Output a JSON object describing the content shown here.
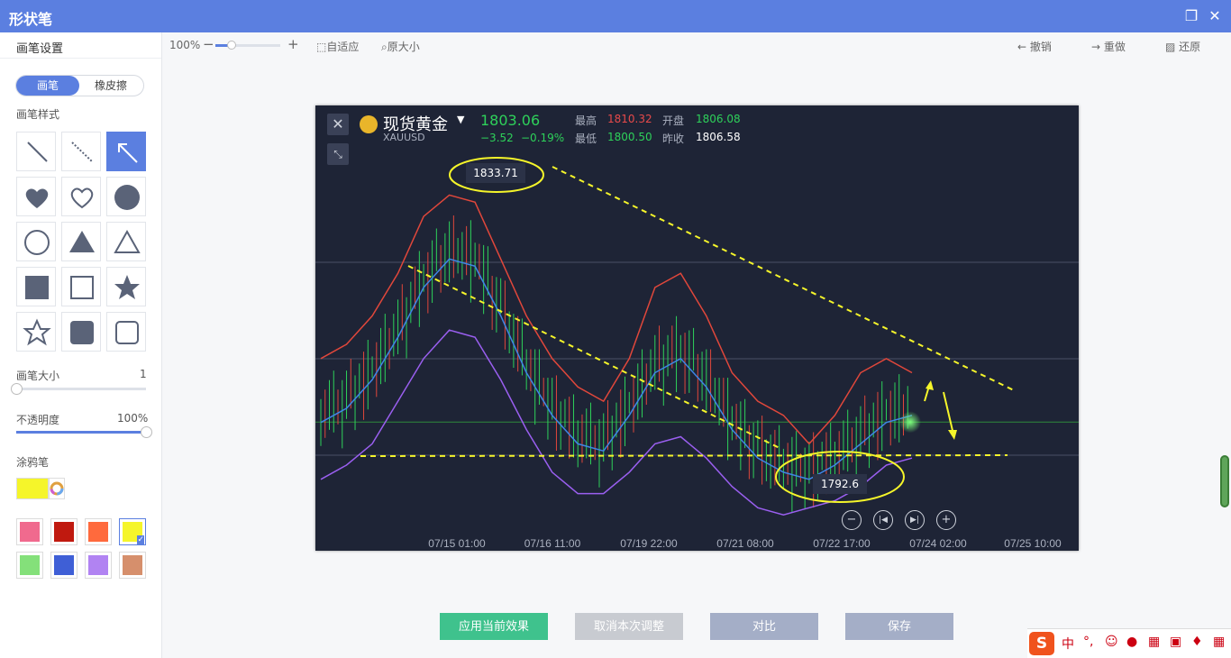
{
  "window": {
    "title": "形状笔"
  },
  "sidebar": {
    "pen_settings_title": "画笔设置",
    "mode_tabs": [
      {
        "label": "画笔",
        "active": true
      },
      {
        "label": "橡皮擦",
        "active": false
      }
    ],
    "pen_style_label": "画笔样式",
    "shapes": [
      "line-solid",
      "line-dashed",
      "arrow",
      "heart-filled",
      "heart-outline",
      "circle-filled",
      "circle-outline",
      "triangle-filled",
      "triangle-outline",
      "square-filled",
      "square-outline",
      "star-filled",
      "star-outline",
      "rounded-square-filled",
      "rounded-square-outline"
    ],
    "active_shape_index": 2,
    "size_label": "画笔大小",
    "size_value": "1",
    "size_fraction": 0.0,
    "opacity_label": "不透明度",
    "opacity_value": "100%",
    "opacity_fraction": 1.0,
    "highlighter_label": "涂鸦笔",
    "current_color": "#f5f52a",
    "palette": [
      "#f06a8e",
      "#c0190f",
      "#ff6a3d",
      "#f5f52a",
      "#84e07a",
      "#3f5fd6",
      "#b183f2",
      "#d68f6c"
    ],
    "selected_palette_index": 3
  },
  "toolbar": {
    "zoom_label": "100%",
    "zoom_minus": "−",
    "zoom_plus": "+",
    "zoom_fraction": 0.25,
    "fit_label": "自适应",
    "original_label": "原大小",
    "undo_label": "撤销",
    "redo_label": "重做",
    "restore_label": "还原"
  },
  "chart_header": {
    "name": "现货黄金",
    "symbol": "XAUUSD",
    "price": "1803.06",
    "change": "−3.52",
    "change_pct": "−0.19%",
    "high_label": "最高",
    "high": "1810.32",
    "open_label": "开盘",
    "open": "1806.08",
    "low_label": "最低",
    "low": "1800.50",
    "prev_close_label": "昨收",
    "prev_close": "1806.58",
    "annotation_high": "1833.71",
    "annotation_low": "1792.6"
  },
  "chart_data": {
    "type": "line",
    "title": "",
    "xlabel": "",
    "ylabel": "",
    "x_ticks": [
      "07/15 01:00",
      "07/16 11:00",
      "07/19 22:00",
      "07/21 08:00",
      "07/22 17:00",
      "07/24 02:00",
      "07/25 10:00"
    ],
    "ylim": [
      1788,
      1840
    ],
    "grid": true,
    "series": [
      {
        "color": "#e0473b",
        "values": [
          1812,
          1814,
          1818,
          1824,
          1832,
          1835,
          1834,
          1826,
          1818,
          1812,
          1808,
          1806,
          1812,
          1822,
          1824,
          1818,
          1810,
          1806,
          1804,
          1800,
          1804,
          1810,
          1812,
          1810
        ]
      },
      {
        "color": "#3f86e6",
        "values": [
          1803,
          1805,
          1809,
          1815,
          1822,
          1826,
          1825,
          1818,
          1810,
          1804,
          1800,
          1799,
          1804,
          1810,
          1812,
          1808,
          1802,
          1798,
          1796,
          1795,
          1797,
          1800,
          1803,
          1804
        ]
      },
      {
        "color": "#9a5ff0",
        "values": [
          1795,
          1797,
          1800,
          1806,
          1812,
          1816,
          1815,
          1809,
          1802,
          1796,
          1793,
          1793,
          1796,
          1800,
          1801,
          1798,
          1794,
          1791,
          1790,
          1791,
          1792,
          1794,
          1797,
          1798
        ]
      }
    ],
    "current_price": 1803.06
  },
  "actions": {
    "apply_label": "应用当前效果",
    "cancel_label": "取消本次调整",
    "compare_label": "对比",
    "save_label": "保存"
  },
  "tray": {
    "ime_label": "中",
    "punct": "°,"
  }
}
